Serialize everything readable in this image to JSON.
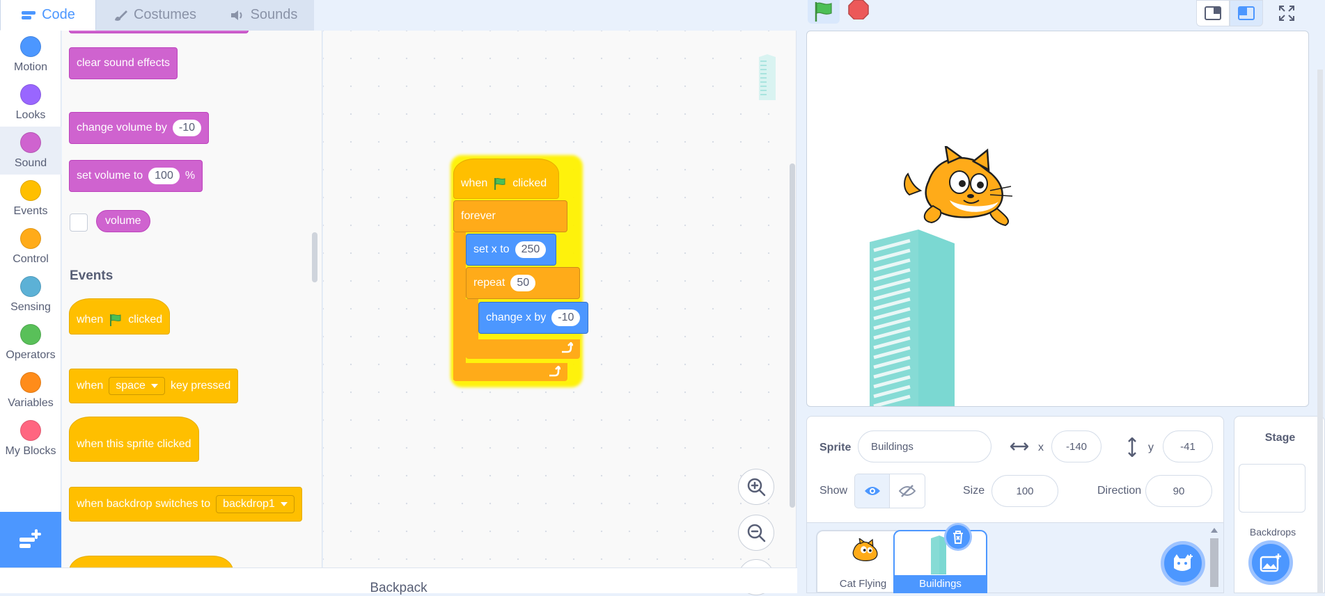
{
  "tabs": [
    {
      "label": "Code"
    },
    {
      "label": "Costumes"
    },
    {
      "label": "Sounds"
    }
  ],
  "categories": [
    {
      "label": "Motion",
      "color": "#4c97ff"
    },
    {
      "label": "Looks",
      "color": "#9966ff"
    },
    {
      "label": "Sound",
      "color": "#cf63cf"
    },
    {
      "label": "Events",
      "color": "#ffbf00"
    },
    {
      "label": "Control",
      "color": "#ffab19"
    },
    {
      "label": "Sensing",
      "color": "#5cb1d6"
    },
    {
      "label": "Operators",
      "color": "#59c059"
    },
    {
      "label": "Variables",
      "color": "#ff8c1a"
    },
    {
      "label": "My Blocks",
      "color": "#ff6680"
    }
  ],
  "palette": {
    "clear_sound_effects": "clear sound effects",
    "change_volume": {
      "label": "change volume by",
      "value": "-10"
    },
    "set_volume": {
      "label": "set volume to",
      "value": "100",
      "unit": "%"
    },
    "volume": "volume",
    "events_title": "Events",
    "when_flag": {
      "before": "when",
      "after": "clicked"
    },
    "when_key": {
      "before": "when",
      "key": "space",
      "after": "key pressed"
    },
    "when_sprite_clicked": "when this sprite clicked",
    "when_backdrop": {
      "label": "when backdrop switches to",
      "value": "backdrop1"
    }
  },
  "script": {
    "hat": {
      "before": "when",
      "after": "clicked"
    },
    "forever": "forever",
    "set_x": {
      "label": "set x to",
      "value": "250"
    },
    "repeat": {
      "label": "repeat",
      "value": "50"
    },
    "change_x": {
      "label": "change x by",
      "value": "-10"
    }
  },
  "backpack": "Backpack",
  "sprite_info": {
    "sprite_label": "Sprite",
    "sprite_name": "Buildings",
    "x_label": "x",
    "x_value": "-140",
    "y_label": "y",
    "y_value": "-41",
    "show_label": "Show",
    "size_label": "Size",
    "size_value": "100",
    "direction_label": "Direction",
    "direction_value": "90"
  },
  "sprites": [
    {
      "name": "Cat Flying",
      "selected": false
    },
    {
      "name": "Buildings",
      "selected": true
    }
  ],
  "stage_panel": {
    "title": "Stage",
    "backdrops_label": "Backdrops"
  },
  "colors": {
    "accent": "#4c97ff",
    "sound": "#cf63cf",
    "events": "#ffbf00",
    "control": "#ffab19",
    "motion": "#4c97ff",
    "glow": "#fff200"
  }
}
